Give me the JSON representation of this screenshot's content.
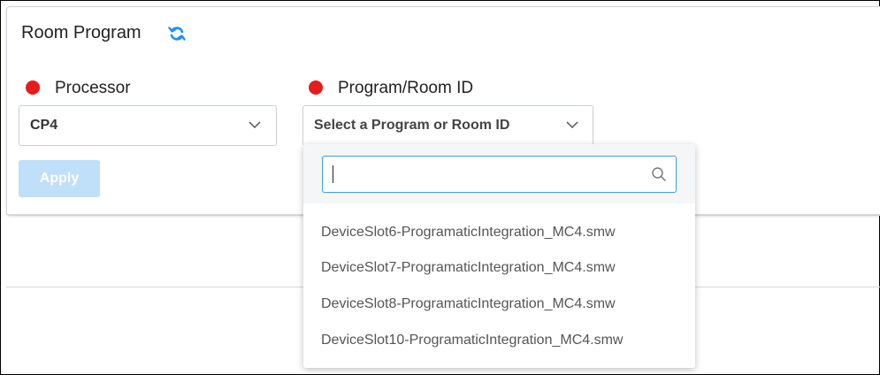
{
  "panel": {
    "title": "Room Program"
  },
  "processor": {
    "label": "Processor",
    "value": "CP4"
  },
  "program": {
    "label": "Program/Room ID",
    "placeholder": "Select a Program or Room ID"
  },
  "apply_label": "Apply",
  "dropdown": {
    "search_value": "",
    "options": [
      "DeviceSlot6-ProgramaticIntegration_MC4.smw",
      "DeviceSlot7-ProgramaticIntegration_MC4.smw",
      "DeviceSlot8-ProgramaticIntegration_MC4.smw",
      "DeviceSlot10-ProgramaticIntegration_MC4.smw"
    ]
  },
  "colors": {
    "required": "#e51c1c",
    "accent": "#1e90ff",
    "apply_disabled": "#bfe0f8"
  }
}
